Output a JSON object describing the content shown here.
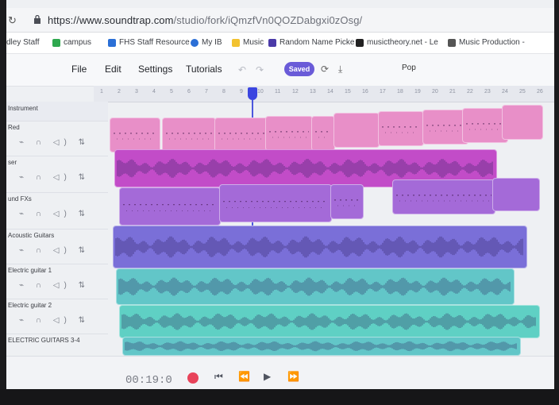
{
  "browser": {
    "url_host": "https://www.soundtrap.com",
    "url_path": "/studio/fork/iQmzfVn0QOZDabgxi0zOsg/"
  },
  "bookmarks": [
    {
      "label": "dley Staff",
      "color": "#ffffff"
    },
    {
      "label": "campus",
      "color": "#2fa84f"
    },
    {
      "label": "FHS Staff Resource",
      "color": "#2b6fd6"
    },
    {
      "label": "My IB",
      "color": "#2b6fd6"
    },
    {
      "label": "Music",
      "color": "#f2c230"
    },
    {
      "label": "Random Name Picke",
      "color": "#4b3aa8"
    },
    {
      "label": "musictheory.net - Le",
      "color": "#222222"
    },
    {
      "label": "Music Production -",
      "color": "#555555"
    }
  ],
  "toolbar": {
    "menu": [
      "File",
      "Edit",
      "Settings",
      "Tutorials"
    ],
    "saved_label": "Saved",
    "project_title": "Pop"
  },
  "ruler": {
    "marks": [
      "1",
      "2",
      "3",
      "4",
      "5",
      "6",
      "7",
      "8",
      "9",
      "10",
      "11",
      "12",
      "13",
      "14",
      "15",
      "16",
      "17",
      "18",
      "19",
      "20",
      "21",
      "22",
      "23",
      "24",
      "25",
      "26"
    ]
  },
  "tracks": [
    {
      "name": "Instrument",
      "label_visible": true
    },
    {
      "name": "Red"
    },
    {
      "name": "ser"
    },
    {
      "name": "und FXs"
    },
    {
      "name": "Acoustic Guitars"
    },
    {
      "name": "Electric guitar 1"
    },
    {
      "name": "Electric guitar 2"
    },
    {
      "name": "ELECTRIC GUITARS 3-4"
    }
  ],
  "transport": {
    "timecode": "00:19:0"
  },
  "colors": {
    "pink": "#e88fc8",
    "magenta": "#c24cc8",
    "violet": "#a46ad8",
    "indigo": "#7a6fd8",
    "teal": "#62c6c8",
    "aqua": "#5fd0c4",
    "playhead": "#2f3cd8"
  }
}
